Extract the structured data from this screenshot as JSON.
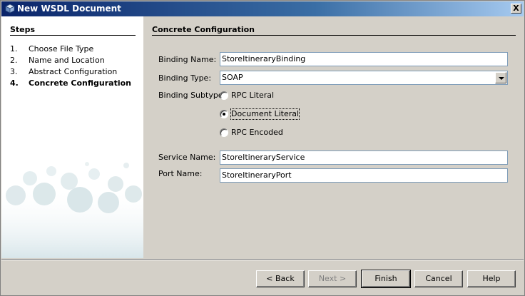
{
  "window": {
    "title": "New WSDL Document",
    "close_label": "X"
  },
  "steps": {
    "title": "Steps",
    "items": [
      {
        "num": "1.",
        "label": "Choose File Type"
      },
      {
        "num": "2.",
        "label": "Name and Location"
      },
      {
        "num": "3.",
        "label": "Abstract Configuration"
      },
      {
        "num": "4.",
        "label": "Concrete Configuration"
      }
    ],
    "current_index": 3
  },
  "content": {
    "title": "Concrete Configuration",
    "binding_name": {
      "label": "Binding Name:",
      "value": "StoreItineraryBinding"
    },
    "binding_type": {
      "label": "Binding Type:",
      "value": "SOAP"
    },
    "binding_subtype": {
      "label": "Binding Subtype:",
      "options": [
        "RPC Literal",
        "Document Literal",
        "RPC Encoded"
      ],
      "selected": "Document Literal"
    },
    "service_name": {
      "label": "Service Name:",
      "value": "StoreItineraryService"
    },
    "port_name": {
      "label": "Port Name:",
      "value": "StoreItineraryPort"
    }
  },
  "buttons": {
    "back": "< Back",
    "next": "Next >",
    "finish": "Finish",
    "cancel": "Cancel",
    "help": "Help"
  },
  "colors": {
    "titlebar_start": "#0a246a",
    "titlebar_end": "#a6caf0",
    "dialog_bg": "#d4d0c8",
    "field_border": "#7f9db9"
  }
}
